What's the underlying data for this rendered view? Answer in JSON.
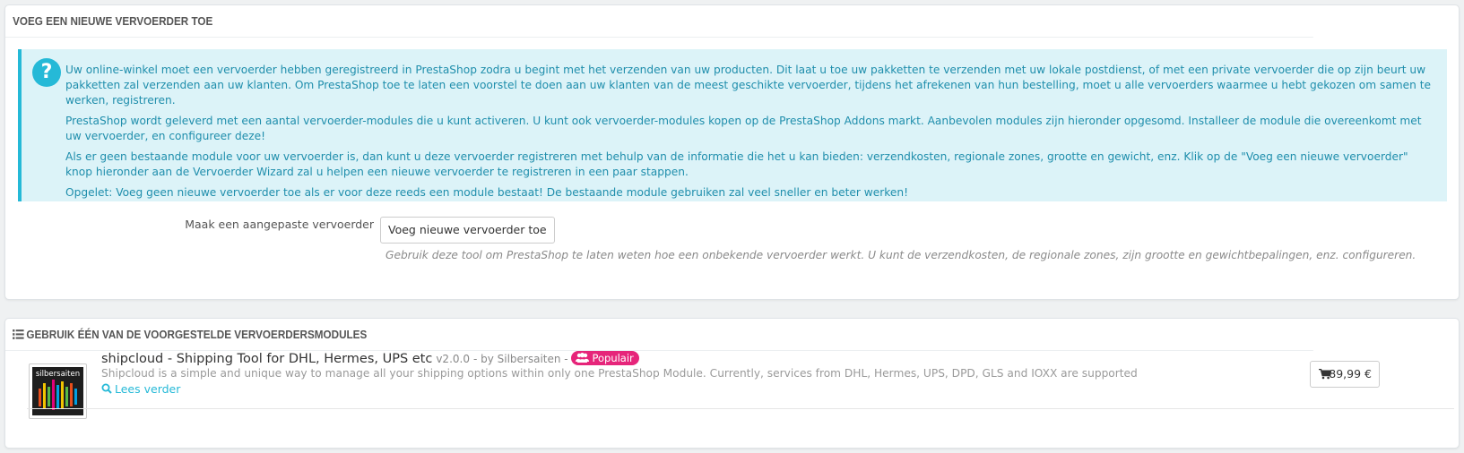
{
  "panel_add": {
    "heading": "VOEG EEN NIEUWE VERVOERDER TOE",
    "alert": {
      "icon": "question-icon",
      "paragraphs": [
        "Uw online-winkel moet een vervoerder hebben geregistreerd in PrestaShop zodra u begint met het verzenden van uw producten. Dit laat u toe uw pakketten te verzenden met uw lokale postdienst, of met een private vervoerder die op zijn beurt uw pakketten zal verzenden aan uw klanten. Om PrestaShop toe te laten een voorstel te doen aan uw klanten van de meest geschikte vervoerder, tijdens het afrekenen van hun bestelling, moet u alle vervoerders waarmee u hebt gekozen om samen te werken, registreren.",
        "PrestaShop wordt geleverd met een aantal vervoerder-modules die u kunt activeren. U kunt ook vervoerder-modules kopen op de PrestaShop Addons markt. Aanbevolen modules zijn hieronder opgesomd. Installeer de module die overeenkomt met uw vervoerder, en configureer deze!",
        "Als er geen bestaande module voor uw vervoerder is, dan kunt u deze vervoerder registreren met behulp van de informatie die het u kan bieden: verzendkosten, regionale zones, grootte en gewicht, enz. Klik op de \"Voeg een nieuwe vervoerder\" knop hieronder aan de Vervoerder Wizard zal u helpen een nieuwe vervoerder te registreren in een paar stappen.",
        "Opgelet: Voeg geen nieuwe vervoerder toe als er voor deze reeds een module bestaat! De bestaande module gebruiken zal veel sneller en beter werken!"
      ]
    },
    "form_label": "Maak een aangepaste vervoerder",
    "add_button": "Voeg nieuwe vervoerder toe",
    "help_text": "Gebruik deze tool om PrestaShop te laten weten hoe een onbekende vervoerder werkt. U kunt de verzendkosten, de regionale zones, zijn grootte en gewichtbepalingen, enz. configureren."
  },
  "panel_modules": {
    "heading": "GEBRUIK ÉÉN VAN DE VOORGESTELDE VERVOERDERSMODULES",
    "heading_icon": "list-icon",
    "modules": [
      {
        "logo_text": "silbersaiten",
        "name": "shipcloud - Shipping Tool for DHL, Hermes, UPS etc",
        "version": "v2.0.0",
        "author": "- by Silbersaiten",
        "separator": " - ",
        "badge": "Populair",
        "badge_icon": "users-icon",
        "badge_color": "#e6257a",
        "description": "Shipcloud is a simple and unique way to manage all your shipping options within only one PrestaShop Module. Currently, services from DHL, Hermes, UPS, DPD, GLS and IOXX are supported",
        "read_more": "Lees verder",
        "price": "89,99 €",
        "price_icon": "cart-icon"
      }
    ]
  },
  "colors": {
    "accent": "#25b9d7",
    "alert_bg": "#dcf3f8",
    "alert_text": "#1f8eac",
    "badge": "#e6257a"
  }
}
